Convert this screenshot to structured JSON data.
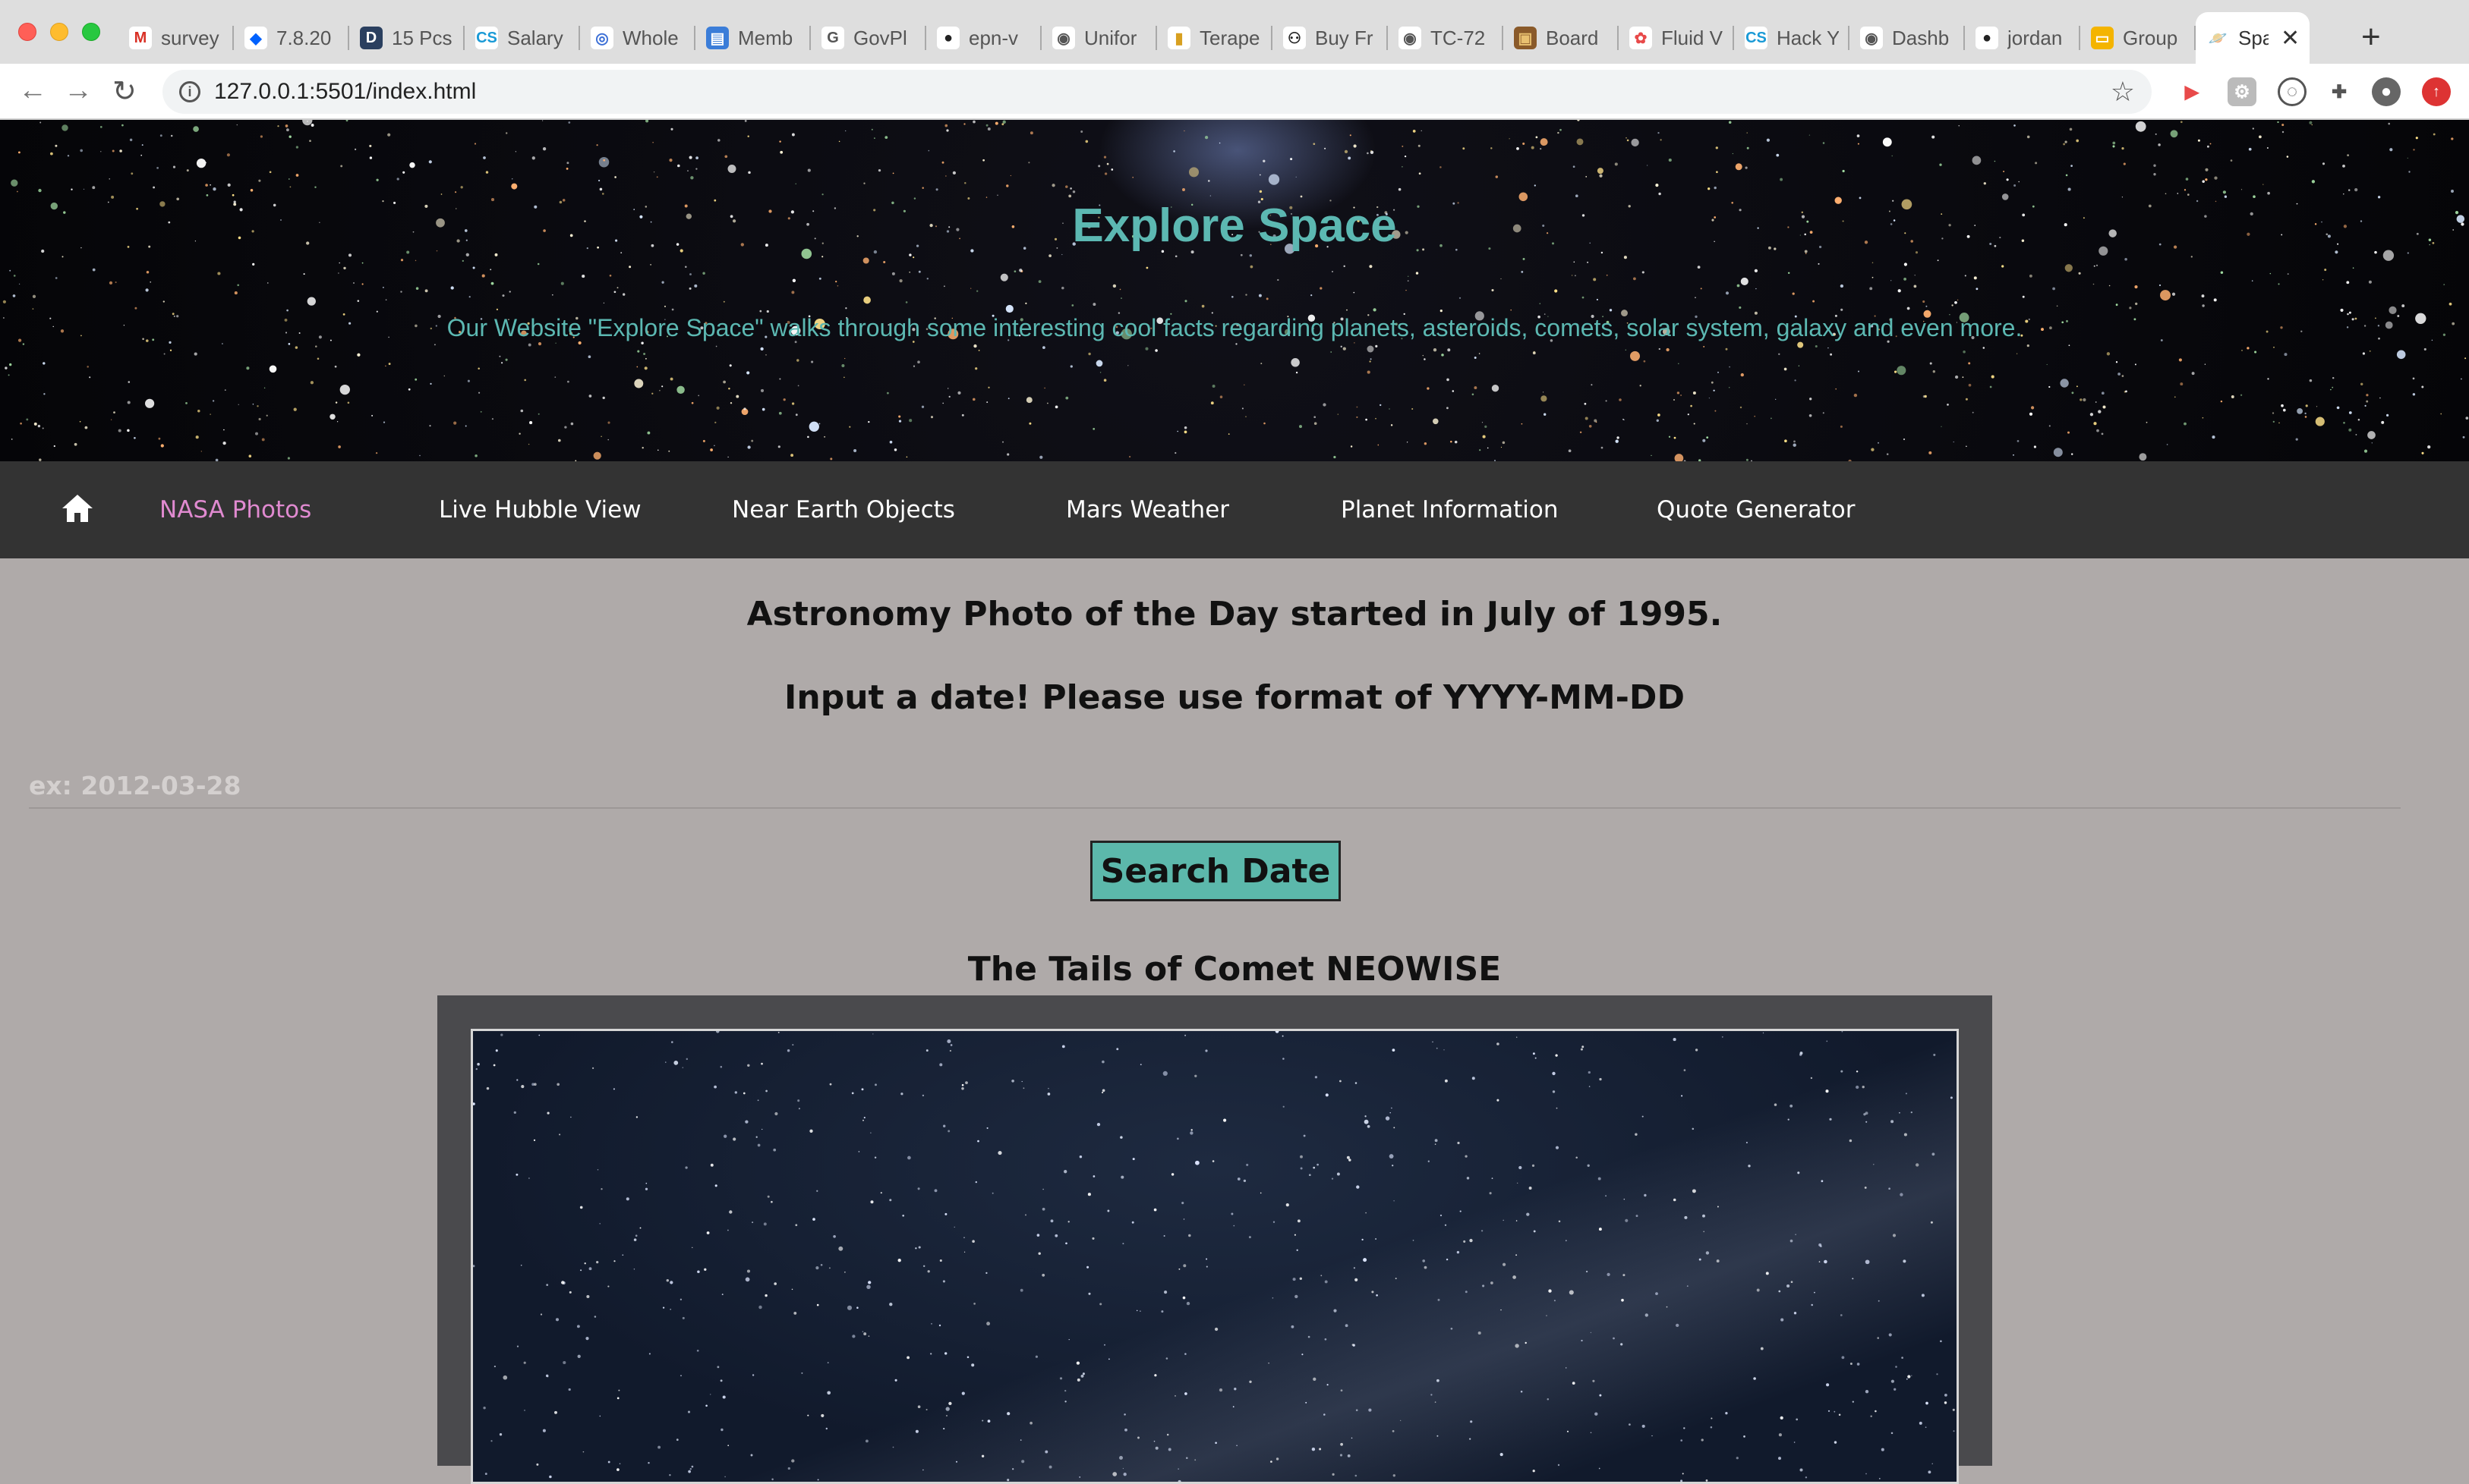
{
  "browser": {
    "tabs": [
      {
        "title": "survey",
        "icon": "gmail-icon",
        "color": "#ffffff",
        "glyph": "M",
        "fg": "#d93025"
      },
      {
        "title": "7.8.20",
        "icon": "dropbox-icon",
        "color": "#ffffff",
        "glyph": "◆",
        "fg": "#0061fe"
      },
      {
        "title": "15 Pcs",
        "icon": "d-letter-icon",
        "color": "#2a3f5f",
        "glyph": "D",
        "fg": "#ffffff"
      },
      {
        "title": "Salary",
        "icon": "codesignal-icon",
        "color": "#ffffff",
        "glyph": "CS",
        "fg": "#1a9ad6"
      },
      {
        "title": "Whole",
        "icon": "target-icon",
        "color": "#ffffff",
        "glyph": "◎",
        "fg": "#3b6fd6"
      },
      {
        "title": "Memb",
        "icon": "document-icon",
        "color": "#3b7dd8",
        "glyph": "▤",
        "fg": "#ffffff"
      },
      {
        "title": "GovPl",
        "icon": "govpilot-icon",
        "color": "#ffffff",
        "glyph": "G",
        "fg": "#555555"
      },
      {
        "title": "epn-v",
        "icon": "github-icon",
        "color": "#ffffff",
        "glyph": "●",
        "fg": "#222222"
      },
      {
        "title": "Unifor",
        "icon": "globe-icon",
        "color": "#ffffff",
        "glyph": "◉",
        "fg": "#555555"
      },
      {
        "title": "Terape",
        "icon": "bag-icon",
        "color": "#ffffff",
        "glyph": "▮",
        "fg": "#d8a020"
      },
      {
        "title": "Buy Fr",
        "icon": "people-icon",
        "color": "#ffffff",
        "glyph": "⚇",
        "fg": "#222222"
      },
      {
        "title": "TC-72",
        "icon": "globe-icon",
        "color": "#ffffff",
        "glyph": "◉",
        "fg": "#555555"
      },
      {
        "title": "Board",
        "icon": "image-icon",
        "color": "#8a5a2a",
        "glyph": "▣",
        "fg": "#e8c070"
      },
      {
        "title": "Fluid V",
        "icon": "flower-icon",
        "color": "#ffffff",
        "glyph": "✿",
        "fg": "#e84a4a"
      },
      {
        "title": "Hack Y",
        "icon": "codesignal-icon",
        "color": "#ffffff",
        "glyph": "CS",
        "fg": "#1a9ad6"
      },
      {
        "title": "Dashb",
        "icon": "globe-icon",
        "color": "#ffffff",
        "glyph": "◉",
        "fg": "#555555"
      },
      {
        "title": "jordan",
        "icon": "github-icon",
        "color": "#ffffff",
        "glyph": "●",
        "fg": "#222222"
      },
      {
        "title": "Group",
        "icon": "slides-icon",
        "color": "#f4b400",
        "glyph": "▭",
        "fg": "#ffffff"
      }
    ],
    "active_tab": {
      "title": "Spa",
      "icon": "planet-icon"
    },
    "url": "127.0.0.1:5501/index.html"
  },
  "hero": {
    "title": "Explore Space",
    "subtitle": "Our Website \"Explore Space\" walks through some interesting cool facts regarding planets, asteroids, comets, solar system, galaxy and even more."
  },
  "nav": {
    "items": [
      {
        "label": "NASA Photos",
        "active": true
      },
      {
        "label": "Live Hubble View",
        "active": false
      },
      {
        "label": "Near Earth Objects",
        "active": false
      },
      {
        "label": "Mars Weather",
        "active": false
      },
      {
        "label": "Planet Information",
        "active": false
      },
      {
        "label": "Quote Generator",
        "active": false
      }
    ]
  },
  "main": {
    "intro": "Astronomy Photo of the Day started in July of 1995.",
    "instruction": "Input a date! Please use format of YYYY-MM-DD",
    "date_input": {
      "value": "",
      "placeholder": "ex: 2012-03-28"
    },
    "search_button": "Search Date",
    "photo_title": "The Tails of Comet NEOWISE"
  },
  "colors": {
    "accent": "#5cb8b2",
    "nav_bg": "#333333",
    "nav_active": "#e08ad0",
    "page_bg": "#afaaa9"
  }
}
